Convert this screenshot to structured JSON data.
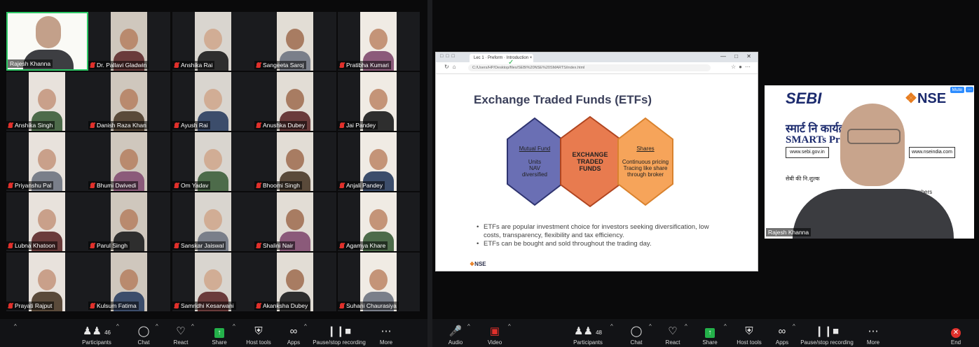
{
  "left": {
    "participants": [
      {
        "name": "Rajesh Khanna",
        "host": true
      },
      {
        "name": "Dr. Pallavi Gladwin"
      },
      {
        "name": "Anshika Rai"
      },
      {
        "name": "Sangeeta Saroj"
      },
      {
        "name": "Pratibha Kumari"
      },
      {
        "name": "Anshika Singh"
      },
      {
        "name": "Danish Raza Khan"
      },
      {
        "name": "Ayush Rai"
      },
      {
        "name": "Anushka Dubey"
      },
      {
        "name": "Jai Pandey"
      },
      {
        "name": "Priyanshu Pal"
      },
      {
        "name": "Bhumi Dwivedi"
      },
      {
        "name": "Om Yadav"
      },
      {
        "name": "Bhoomi Singh"
      },
      {
        "name": "Anjali Pandey"
      },
      {
        "name": "Lubna Khatoon"
      },
      {
        "name": "Parul Singh"
      },
      {
        "name": "Sanskar Jaiswal"
      },
      {
        "name": "Shalini Nair"
      },
      {
        "name": "Agamya Khare"
      },
      {
        "name": "Prayati Rajput"
      },
      {
        "name": "Kulsum Fatima"
      },
      {
        "name": "Samridhi Kesarwani"
      },
      {
        "name": "Akanksha Dubey"
      },
      {
        "name": "Suhani Chaurasiya"
      }
    ],
    "toolbar": {
      "participants_count": "46",
      "participants": "Participants",
      "chat": "Chat",
      "react": "React",
      "share": "Share",
      "host_tools": "Host tools",
      "apps": "Apps",
      "pause": "Pause/stop recording",
      "more": "More"
    }
  },
  "right": {
    "browser": {
      "tab_title": "Lec 1 · Preform · Introduction ×",
      "url": "C:/Users/HP/Desktop/files/SEBI%20NSE%20SMARTS/index.html"
    },
    "slide": {
      "title": "Exchange Traded Funds (ETFs)",
      "hex_left": {
        "heading": "Mutual Fund",
        "lines": [
          "Units",
          "NAV",
          "diversified"
        ]
      },
      "hex_center": {
        "lines": [
          "EXCHANGE",
          "TRADED",
          "FUNDS"
        ]
      },
      "hex_right": {
        "heading": "Shares",
        "lines": [
          "Continuous pricing",
          "Tracing like share",
          "through broker"
        ]
      },
      "bullet1": "ETFs are popular investment choice for investors seeking diversification, low costs, transparency, flexibility and tax efficiency.",
      "bullet2": "ETFs can be bought and sold throughout the trading day.",
      "logo": "NSE"
    },
    "speaker": {
      "name": "Rajesh Khanna",
      "mute": "Mute",
      "banner_seb": "SEBI",
      "banner_nse": "NSE",
      "banner_hindi": "स्मार्ट नि          कार्यक्रम",
      "banner_en": "SMARTs          Program",
      "link1": "www.sebi.gov.in",
      "link2": "www.nseindia.com",
      "line3": "सेबी की नि.शुल्क",
      "line4": "e Numbers"
    },
    "toolbar": {
      "audio": "Audio",
      "video": "Video",
      "participants_count": "48",
      "participants": "Participants",
      "chat": "Chat",
      "react": "React",
      "share": "Share",
      "host_tools": "Host tools",
      "apps": "Apps",
      "pause": "Pause/stop recording",
      "more": "More",
      "end": "End"
    }
  }
}
